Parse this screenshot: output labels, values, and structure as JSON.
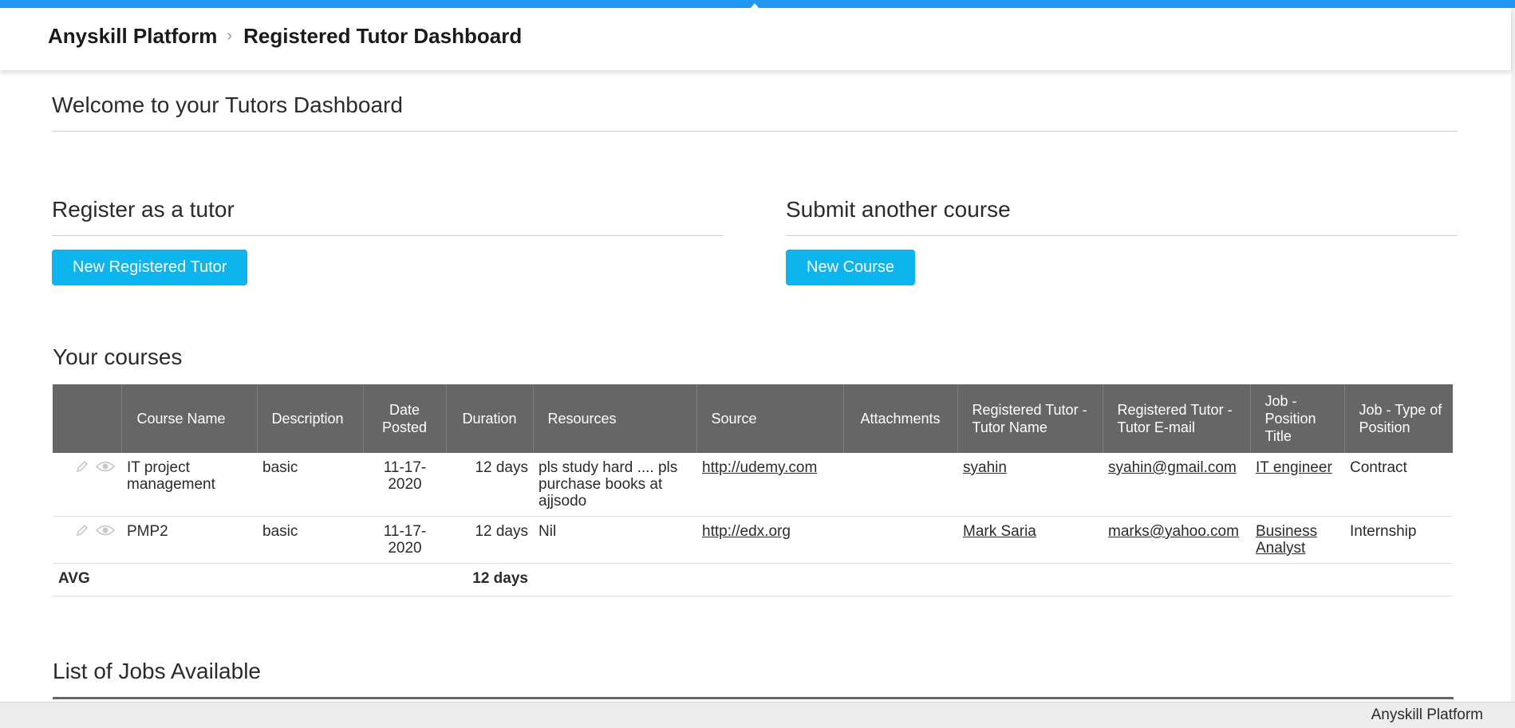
{
  "header": {
    "breadcrumb": [
      "Anyskill Platform",
      "Registered Tutor Dashboard"
    ]
  },
  "welcome": {
    "title": "Welcome to your Tutors Dashboard"
  },
  "register": {
    "title": "Register as a tutor",
    "button_label": "New Registered Tutor"
  },
  "submit": {
    "title": "Submit another course",
    "button_label": "New Course"
  },
  "courses": {
    "title": "Your courses",
    "columns": [
      "",
      "Course Name",
      "Description",
      "Date Posted",
      "Duration",
      "Resources",
      "Source",
      "Attachments",
      "Registered Tutor - Tutor Name",
      "Registered Tutor - Tutor E-mail",
      "Job - Position Title",
      "Job - Type of Position"
    ],
    "rows": [
      {
        "course_name": "IT project management",
        "description": "basic",
        "date_posted": "11-17-2020",
        "duration": "12 days",
        "resources": "pls study hard .... pls purchase books at ajjsodo",
        "source": "http://udemy.com",
        "attachments": "",
        "tutor_name": "syahin",
        "tutor_email": "syahin@gmail.com",
        "position_title": "IT engineer",
        "position_type": "Contract"
      },
      {
        "course_name": "PMP2",
        "description": "basic",
        "date_posted": "11-17-2020",
        "duration": "12 days",
        "resources": "Nil",
        "source": "http://edx.org",
        "attachments": "",
        "tutor_name": "Mark Saria",
        "tutor_email": "marks@yahoo.com",
        "position_title": "Business Analyst",
        "position_type": "Internship"
      }
    ],
    "avg": {
      "label": "AVG",
      "duration": "12 days"
    }
  },
  "jobs": {
    "title": "List of Jobs Available"
  },
  "footer": {
    "text": "Anyskill Platform"
  },
  "colors": {
    "accent": "#2196f3",
    "button": "#0db5ee",
    "table_header": "#666666"
  },
  "icons": {
    "top_tab": "arrow-up-icon",
    "row_edit": "pencil-icon",
    "row_view": "eye-icon",
    "breadcrumb_separator": "chevron-right-icon"
  }
}
